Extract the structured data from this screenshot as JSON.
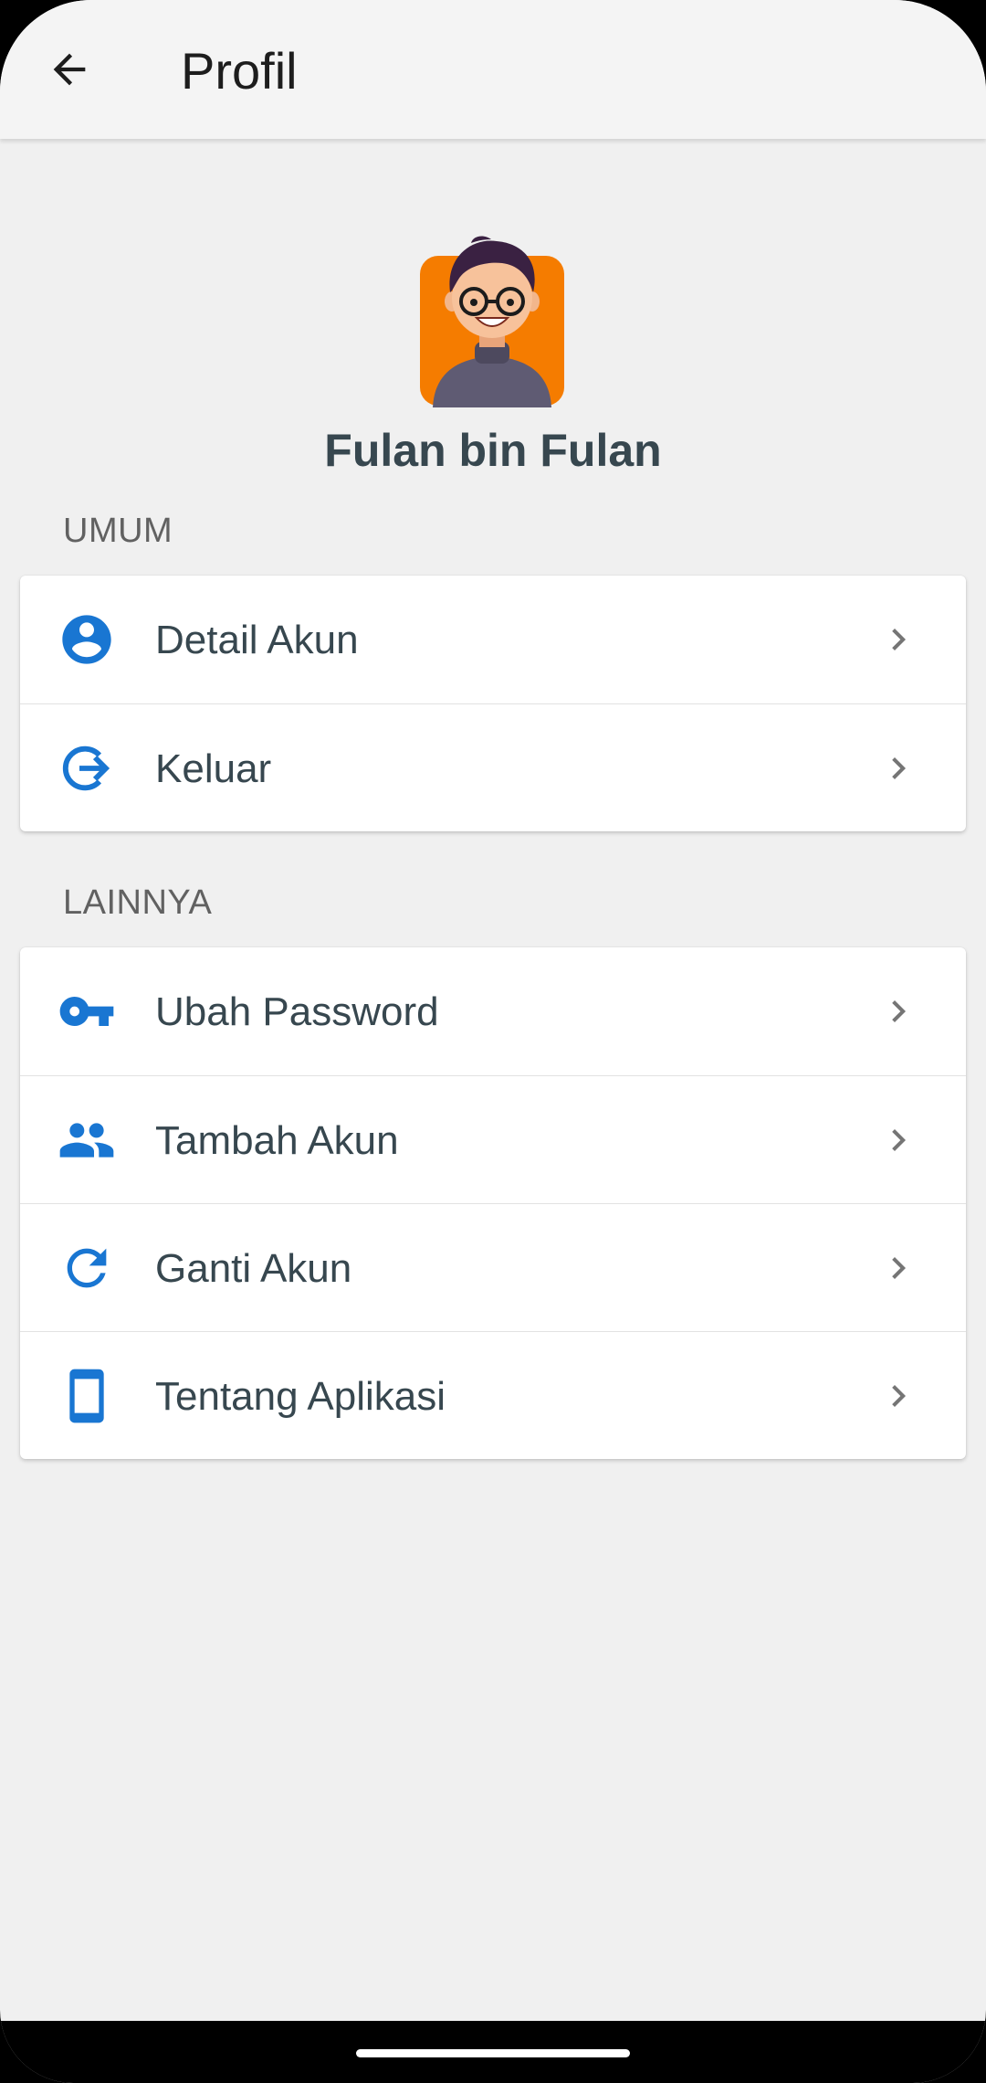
{
  "appbar": {
    "title": "Profil",
    "back_icon": "arrow-back-icon"
  },
  "profile": {
    "name": "Fulan bin Fulan",
    "avatar_background": "#f57c00"
  },
  "sections": {
    "general": {
      "header": "UMUM",
      "items": [
        {
          "label": "Detail Akun",
          "icon": "account-circle-icon"
        },
        {
          "label": "Keluar",
          "icon": "logout-icon"
        }
      ]
    },
    "others": {
      "header": "LAINNYA",
      "items": [
        {
          "label": "Ubah Password",
          "icon": "key-icon"
        },
        {
          "label": "Tambah Akun",
          "icon": "people-icon"
        },
        {
          "label": "Ganti Akun",
          "icon": "refresh-icon"
        },
        {
          "label": "Tentang Aplikasi",
          "icon": "smartphone-icon"
        }
      ]
    }
  },
  "colors": {
    "accent": "#1976d2",
    "text": "#37474f",
    "chevron": "#757575",
    "background": "#f0f0f0"
  }
}
